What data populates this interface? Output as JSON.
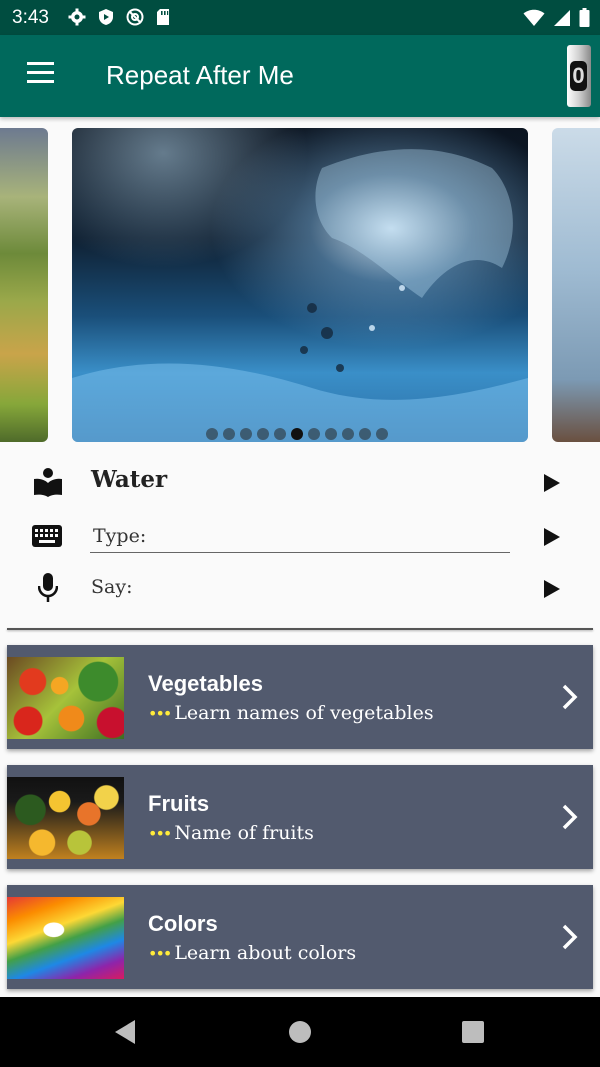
{
  "status_bar": {
    "time": "3:43"
  },
  "app_bar": {
    "title": "Repeat After Me",
    "counter": "0"
  },
  "carousel": {
    "current_index": 6,
    "total": 11
  },
  "word_panel": {
    "word": "Water",
    "type_label": "Type:",
    "say_label": "Say:"
  },
  "categories": [
    {
      "title": "Vegetables",
      "subtitle": "Learn names of vegetables",
      "dots": "•••"
    },
    {
      "title": "Fruits",
      "subtitle": "Name of fruits",
      "dots": "•••"
    },
    {
      "title": "Colors",
      "subtitle": "Learn about colors",
      "dots": "•••"
    }
  ],
  "colors": {
    "status_bar": "#004d40",
    "app_bar": "#00695c",
    "card": "#525a6e",
    "accent_dots": "#ffeb3b"
  },
  "icons": [
    "settings-icon",
    "shield-icon",
    "at-sign-icon",
    "sd-card-icon",
    "wifi-icon",
    "signal-icon",
    "battery-icon",
    "menu-icon",
    "book-reader-icon",
    "keyboard-icon",
    "microphone-icon",
    "play-icon",
    "chevron-right-icon"
  ]
}
